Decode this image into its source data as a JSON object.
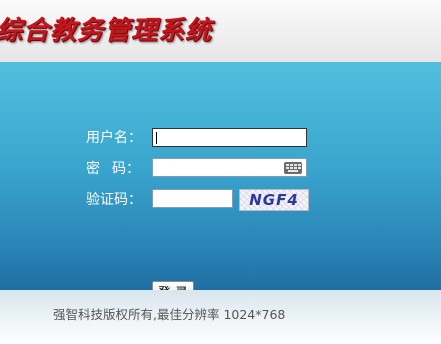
{
  "header": {
    "title": "综合教务管理系统"
  },
  "login": {
    "username_label": "用户名：",
    "password_label_1": "密",
    "password_label_2": "码：",
    "captcha_label": "验证码：",
    "username_value": "",
    "password_value": "",
    "captcha_value": "",
    "captcha_code": "NGF4",
    "keyboard_icon": "keyboard-icon",
    "login_button": "登 录"
  },
  "footer": {
    "copyright": "强智科技版权所有,最佳分辨率 1024*768"
  },
  "colors": {
    "title_red": "#c4151d",
    "panel_top": "#52bfde",
    "panel_bottom": "#1f6fa3"
  }
}
